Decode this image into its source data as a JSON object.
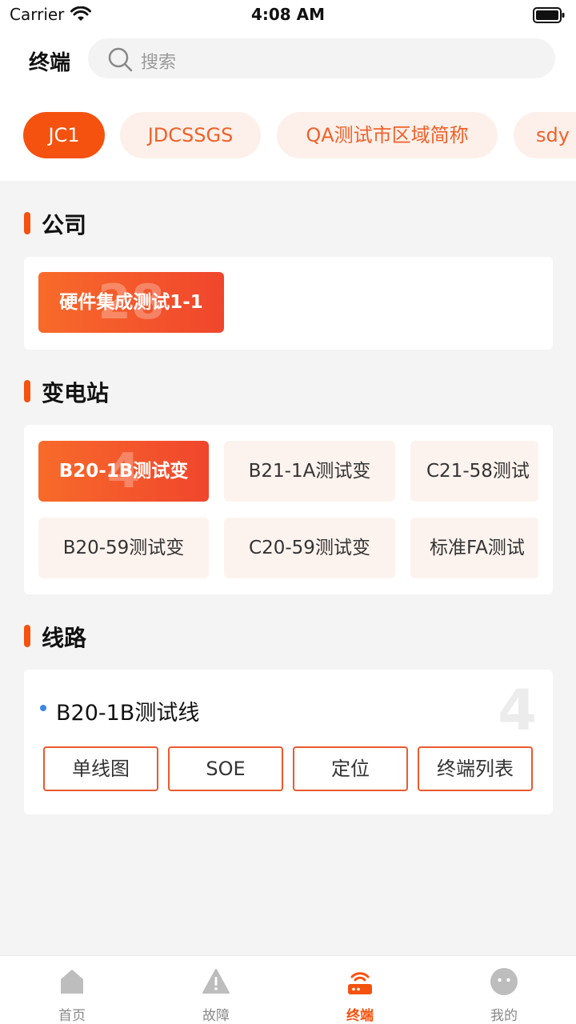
{
  "status_bar": {
    "carrier": "Carrier",
    "time": "4:08 AM"
  },
  "header": {
    "title": "终端",
    "search_placeholder": "搜索"
  },
  "chips": [
    {
      "label": "JC1",
      "active": true
    },
    {
      "label": "JDCSSGS",
      "active": false
    },
    {
      "label": "QA测试市区域简称",
      "active": false
    },
    {
      "label": "sdy",
      "active": false
    }
  ],
  "company": {
    "section_title": "公司",
    "items": [
      {
        "label": "硬件集成测试1-1",
        "count": "28",
        "active": true
      }
    ]
  },
  "substation": {
    "section_title": "变电站",
    "items": [
      {
        "label": "B20-1B测试变",
        "count": "4",
        "active": true
      },
      {
        "label": "B21-1A测试变",
        "active": false
      },
      {
        "label": "C21-58测试",
        "active": false
      },
      {
        "label": "B20-59测试变",
        "active": false
      },
      {
        "label": "C20-59测试变",
        "active": false
      },
      {
        "label": "标准FA测试",
        "active": false
      }
    ]
  },
  "line": {
    "section_title": "线路",
    "name": "B20-1B测试线",
    "count": "4",
    "buttons": [
      "单线图",
      "SOE",
      "定位",
      "终端列表"
    ]
  },
  "tabbar": {
    "items": [
      {
        "label": "首页",
        "icon": "home-icon",
        "active": false
      },
      {
        "label": "故障",
        "icon": "warning-icon",
        "active": false
      },
      {
        "label": "终端",
        "icon": "terminal-router-icon",
        "active": true
      },
      {
        "label": "我的",
        "icon": "profile-face-icon",
        "active": false
      }
    ]
  },
  "colors": {
    "accent": "#f5520f",
    "chip_bg": "#fdf0ea",
    "tile_bg": "#fdf3ee",
    "line_dot": "#3d86e6"
  }
}
